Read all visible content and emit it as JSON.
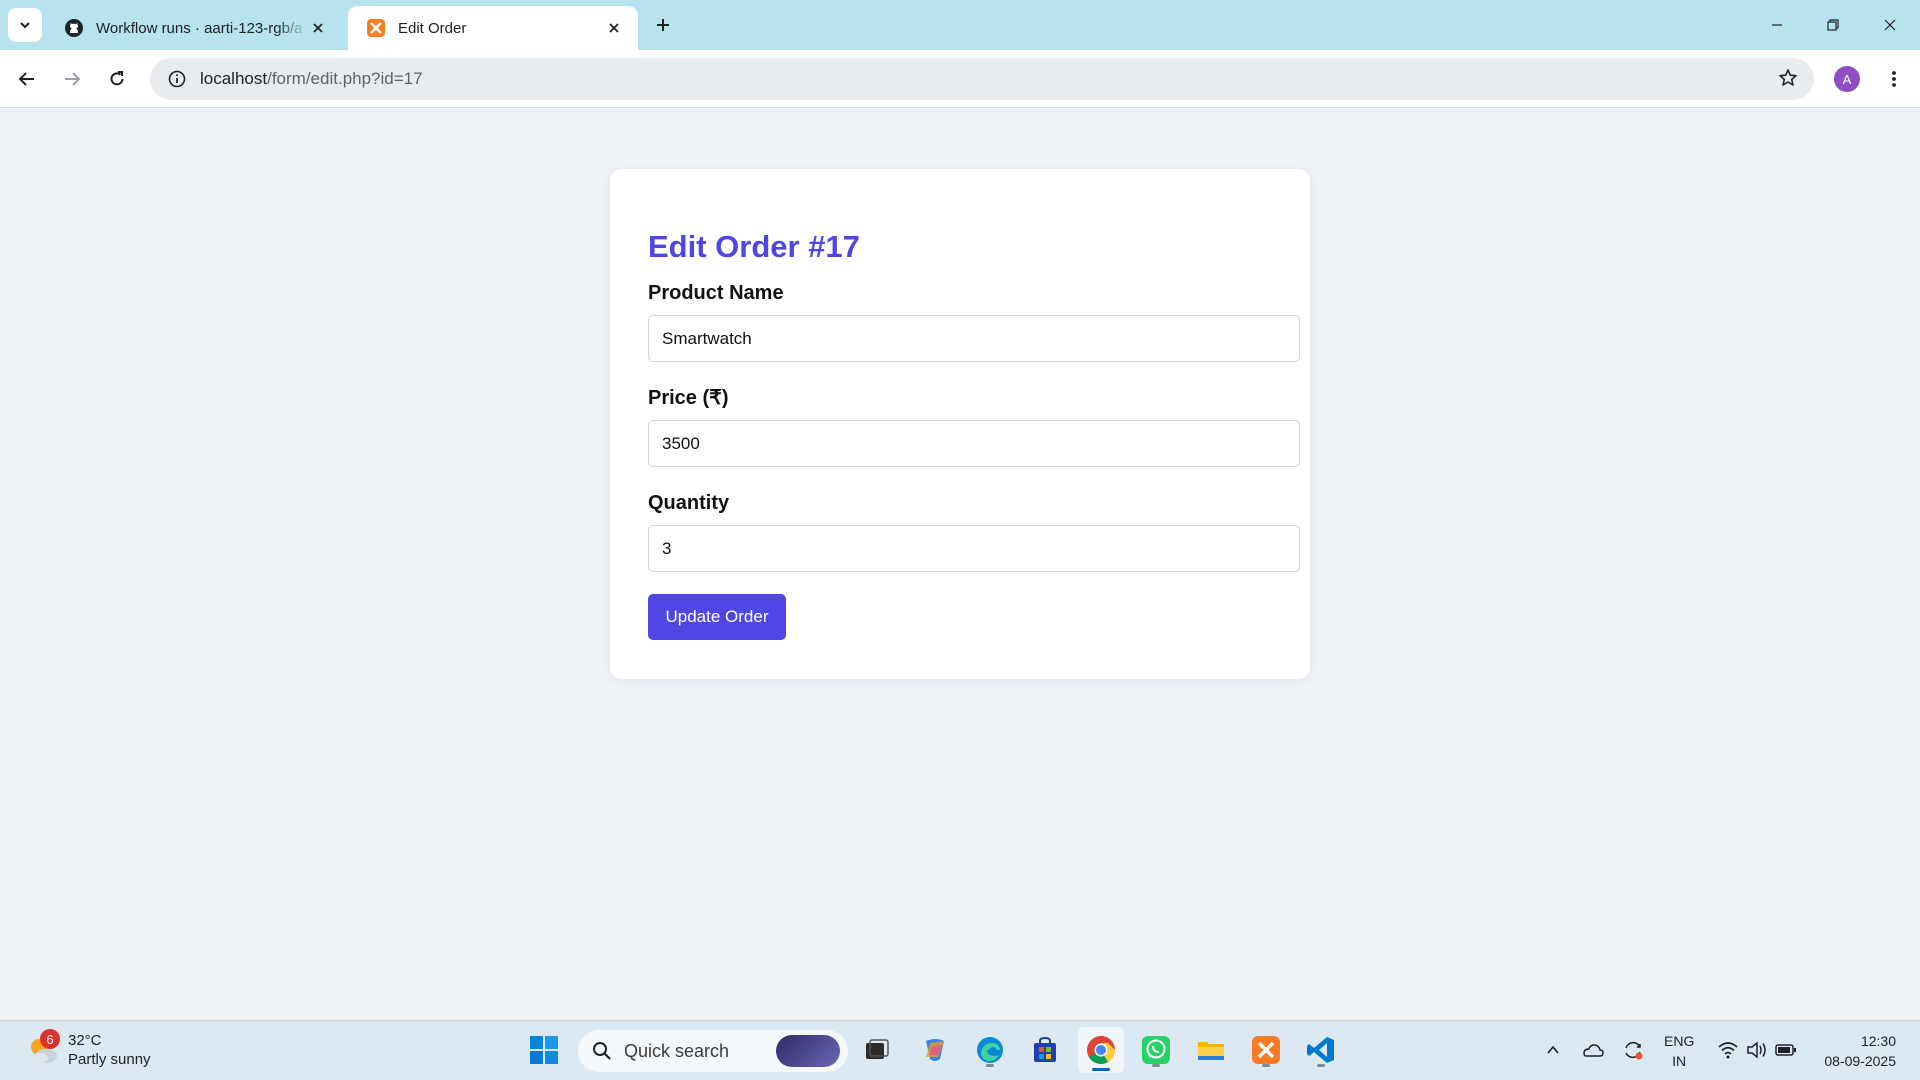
{
  "browser": {
    "tabs": [
      {
        "title": "Workflow runs · aarti-123-rgb/a",
        "favicon": "github-icon",
        "active": false
      },
      {
        "title": "Edit Order",
        "favicon": "xampp-icon",
        "active": true
      }
    ],
    "url_host": "localhost",
    "url_path": "/form/edit.php?id=17",
    "profile_initial": "A"
  },
  "form": {
    "title": "Edit Order #17",
    "product_label": "Product Name",
    "product_value": "Smartwatch",
    "price_label": "Price (₹)",
    "price_value": "3500",
    "quantity_label": "Quantity",
    "quantity_value": "3",
    "submit_label": "Update Order"
  },
  "taskbar": {
    "weather_badge": "6",
    "temperature": "32°C",
    "weather": "Partly sunny",
    "search_placeholder": "Quick search",
    "language": "ENG",
    "region": "IN",
    "time": "12:30",
    "date": "08-09-2025",
    "apps": [
      "windows-start-icon",
      "task-view-icon",
      "copilot-icon",
      "edge-icon",
      "microsoft-store-icon",
      "chrome-icon",
      "whatsapp-icon",
      "file-explorer-icon",
      "xampp-icon",
      "vscode-icon"
    ]
  },
  "colors": {
    "accent": "#4f46e5",
    "page_bg": "#eef2f7",
    "tabstrip_bg": "#b7e3ee"
  }
}
